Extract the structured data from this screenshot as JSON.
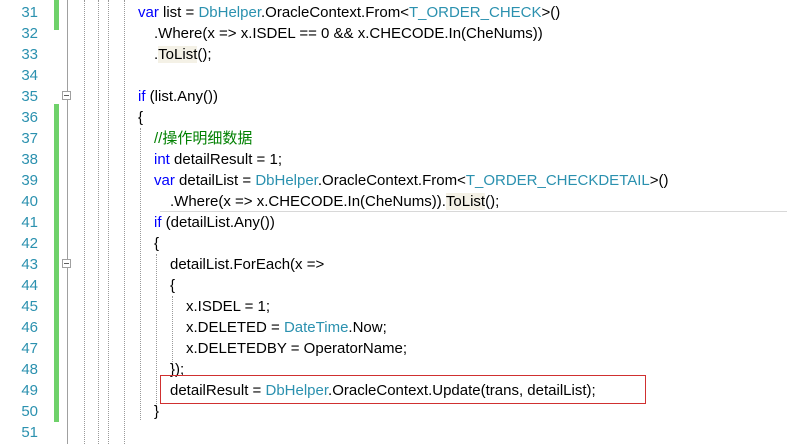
{
  "editor": {
    "line_numbers": [
      "31",
      "32",
      "33",
      "34",
      "35",
      "36",
      "37",
      "38",
      "39",
      "40",
      "41",
      "42",
      "43",
      "44",
      "45",
      "46",
      "47",
      "48",
      "49",
      "50",
      "51"
    ],
    "lines": [
      [
        {
          "t": "var",
          "c": "kw"
        },
        {
          "t": " list = "
        },
        {
          "t": "DbHelper",
          "c": "type"
        },
        {
          "t": ".OracleContext.From<"
        },
        {
          "t": "T_ORDER_CHECK",
          "c": "type"
        },
        {
          "t": ">()"
        }
      ],
      [
        {
          "t": ".Where(x => x.ISDEL == 0 && x.CHECODE.In(CheNums))"
        }
      ],
      [
        {
          "t": "."
        },
        {
          "t": "ToList",
          "c": "hl"
        },
        {
          "t": "();"
        }
      ],
      [],
      [
        {
          "t": "if",
          "c": "kw"
        },
        {
          "t": " (list.Any())"
        }
      ],
      [
        {
          "t": "{"
        }
      ],
      [
        {
          "t": "//操作明细数据",
          "c": "cm"
        }
      ],
      [
        {
          "t": "int",
          "c": "kw"
        },
        {
          "t": " detailResult = 1;"
        }
      ],
      [
        {
          "t": "var",
          "c": "kw"
        },
        {
          "t": " detailList = "
        },
        {
          "t": "DbHelper",
          "c": "type"
        },
        {
          "t": ".OracleContext.From<"
        },
        {
          "t": "T_ORDER_CHECKDETAIL",
          "c": "type"
        },
        {
          "t": ">()"
        }
      ],
      [
        {
          "t": ".Where(x => x.CHECODE.In(CheNums))."
        },
        {
          "t": "ToList",
          "c": "hl"
        },
        {
          "t": "();"
        }
      ],
      [
        {
          "t": "if",
          "c": "kw"
        },
        {
          "t": " (detailList.Any())"
        }
      ],
      [
        {
          "t": "{"
        }
      ],
      [
        {
          "t": "detailList.ForEach(x =>"
        }
      ],
      [
        {
          "t": "{"
        }
      ],
      [
        {
          "t": "x.ISDEL = 1;"
        }
      ],
      [
        {
          "t": "x.DELETED = "
        },
        {
          "t": "DateTime",
          "c": "type"
        },
        {
          "t": ".Now;"
        }
      ],
      [
        {
          "t": "x.DELETEDBY = OperatorName;"
        }
      ],
      [
        {
          "t": "});"
        }
      ],
      [
        {
          "t": "detailResult = "
        },
        {
          "t": "DbHelper",
          "c": "type"
        },
        {
          "t": ".OracleContext.Update(trans, detailList);"
        }
      ],
      [
        {
          "t": "}"
        }
      ],
      []
    ]
  },
  "colors": {
    "keyword": "#0000ff",
    "type": "#2b91af",
    "comment": "#008000",
    "line_number": "#2b91af",
    "change_bar": "#6fd16a",
    "highlight_box": "#d03030"
  }
}
